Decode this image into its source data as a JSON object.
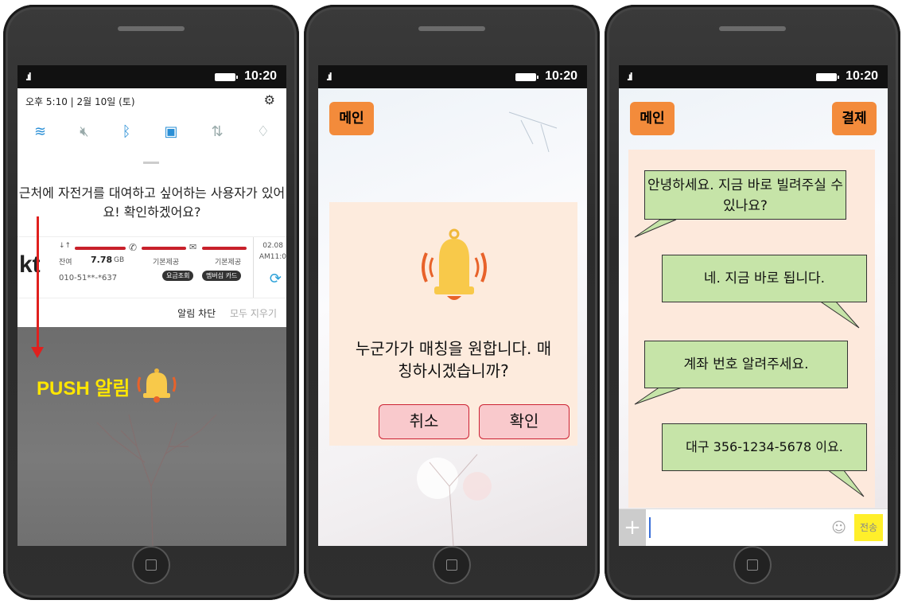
{
  "status_bar": {
    "signal": ".ıl",
    "time": "10:20"
  },
  "phone1": {
    "date": "오후 5:10  |  2월 10일 (토)",
    "message": "근처에 자전거를 대여하고 싶어하는 사용자가 있어요! 확인하겠어요?",
    "kt": {
      "logo": "kt",
      "data_label": "잔여",
      "data_value": "7.78",
      "data_unit": "GB",
      "call_label": "기본제공",
      "msg_label": "기본제공",
      "phone_number": "010-51**-*637",
      "btn_fee": "요금조회",
      "btn_member": "멤버십 카드",
      "date": "02.08",
      "time": "AM11:0"
    },
    "action_block": "알림 차단",
    "action_clear": "모두 지우기",
    "push_label": "PUSH 알림"
  },
  "phone2": {
    "main_button": "메인",
    "dialog_text": "누군가가 매칭을 원합니다. 매칭하시겠습니까?",
    "cancel_button": "취소",
    "confirm_button": "확인"
  },
  "phone3": {
    "main_button": "메인",
    "pay_button": "결제",
    "messages": [
      "안녕하세요. 지금 바로 빌려주실 수 있나요?",
      "네. 지금 바로 됩니다.",
      "계좌 번호 알려주세요.",
      "대구 356-1234-5678 이요."
    ],
    "send_button": "전송",
    "plus_button": "+"
  },
  "colors": {
    "orange": "#f38b3b",
    "bubble_green": "#c6e4a8",
    "chat_bg": "#fde9dc",
    "dialog_bg": "#fdebdd",
    "push_yellow": "#ffe600",
    "arrow_red": "#e0201e"
  }
}
